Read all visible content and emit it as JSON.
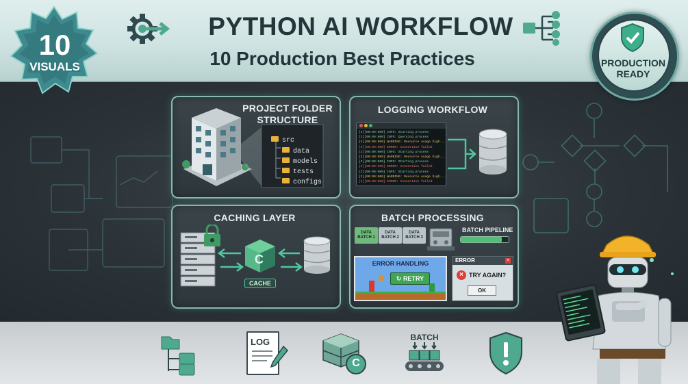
{
  "header": {
    "title": "PYTHON AI WORKFLOW",
    "subtitle": "10 Production Best Practices"
  },
  "badge_left": {
    "number": "10",
    "label": "VISUALS"
  },
  "badge_right": {
    "line1": "PRODUCTION",
    "line2": "READY"
  },
  "cards": {
    "project": {
      "title_line1": "PROJECT FOLDER",
      "title_line2": "STRUCTURE",
      "folders": [
        "src",
        "data",
        "models",
        "tests",
        "configs"
      ]
    },
    "logging": {
      "title": "LOGGING WORKFLOW",
      "log_lines": [
        "[I][00:00:000]  INFO: Starting process",
        "[I][00:00:000]  INFO: Querying process",
        "[I][00:00:000]  WARNING: Resource usage high...",
        "[I][00:00:000]  ERROR: Connection failed",
        "[I][00:00:000]  INFO: Starting process",
        "[I][00:00:000]  WARNING: Resource usage high...",
        "[I][00:00:000]  INFO: Starting process",
        "[I][00:00:000]  ERROR: Connection failed",
        "[I][00:00:000]  INFO: Starting process",
        "[I][00:00:000]  WARNING: Resource usage high...",
        "[I][00:00:000]  ERROR: Connection failed"
      ]
    },
    "caching": {
      "title": "CACHING LAYER",
      "cache_label": "CACHE",
      "cube_letter": "C"
    },
    "batch": {
      "title": "BATCH PROCESSING",
      "folders": [
        "DATA BATCH 1",
        "DATA BATCH 2",
        "DATA BATCH 3"
      ],
      "pipeline_label": "BATCH PIPELINE",
      "error_handling_title": "ERROR HANDLING",
      "retry_label": "RETRY",
      "error_dialog_title": "ERROR",
      "error_dialog_message": "TRY AGAIN?",
      "ok_label": "OK"
    }
  },
  "bottom_icons": {
    "log_label": "LOG",
    "cache_letter": "C",
    "batch_label": "BATCH"
  },
  "colors": {
    "accent_teal": "#4fa98f",
    "card_border": "#88b9ad",
    "dark_bg": "#2c3338",
    "title_text": "#23363a"
  }
}
